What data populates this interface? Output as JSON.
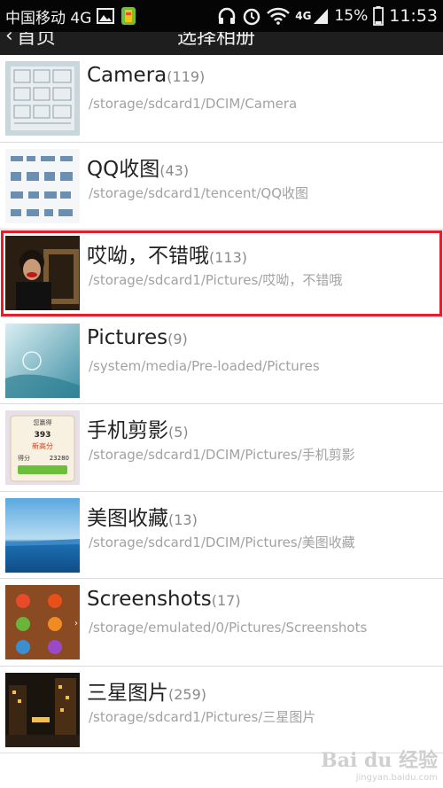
{
  "statusbar": {
    "carrier": "中国移动 4G",
    "net_badge": "4G",
    "battery": "15%",
    "time": "11:53",
    "icons": [
      "picture-icon",
      "app-icon",
      "headphones-icon",
      "alarm-icon",
      "wifi-icon",
      "signal-icon",
      "battery-icon"
    ]
  },
  "header": {
    "back_label": "首页",
    "title": "选择相册"
  },
  "albums": [
    {
      "name": "Camera",
      "count": "(119)",
      "path": "/storage/sdcard1/DCIM/Camera"
    },
    {
      "name": "QQ收图",
      "count": "(43)",
      "path": "/storage/sdcard1/tencent/QQ收图"
    },
    {
      "name": "哎呦，不错哦",
      "count": "(113)",
      "path": "/storage/sdcard1/Pictures/哎呦，不错哦"
    },
    {
      "name": "Pictures",
      "count": "(9)",
      "path": "/system/media/Pre-loaded/Pictures"
    },
    {
      "name": "手机剪影",
      "count": "(5)",
      "path": "/storage/sdcard1/DCIM/Pictures/手机剪影"
    },
    {
      "name": "美图收藏",
      "count": "(13)",
      "path": "/storage/sdcard1/DCIM/Pictures/美图收藏"
    },
    {
      "name": "Screenshots",
      "count": "(17)",
      "path": "/storage/emulated/0/Pictures/Screenshots"
    },
    {
      "name": "三星图片",
      "count": "(259)",
      "path": "/storage/sdcard1/Pictures/三星图片"
    }
  ],
  "selected_index": 2,
  "thumb_texts": {
    "game_label": "您赢得",
    "game_score": "393",
    "game_new": "新高分",
    "game_points_label": "得分",
    "game_points": "23280"
  },
  "watermark": {
    "logo": "Bai du 经验",
    "url": "jingyan.baidu.com"
  },
  "colors": {
    "status_bg": "#050505",
    "selection": "#e0202c",
    "count_text": "#8a8a8a",
    "path_text": "#a2a2a2"
  }
}
